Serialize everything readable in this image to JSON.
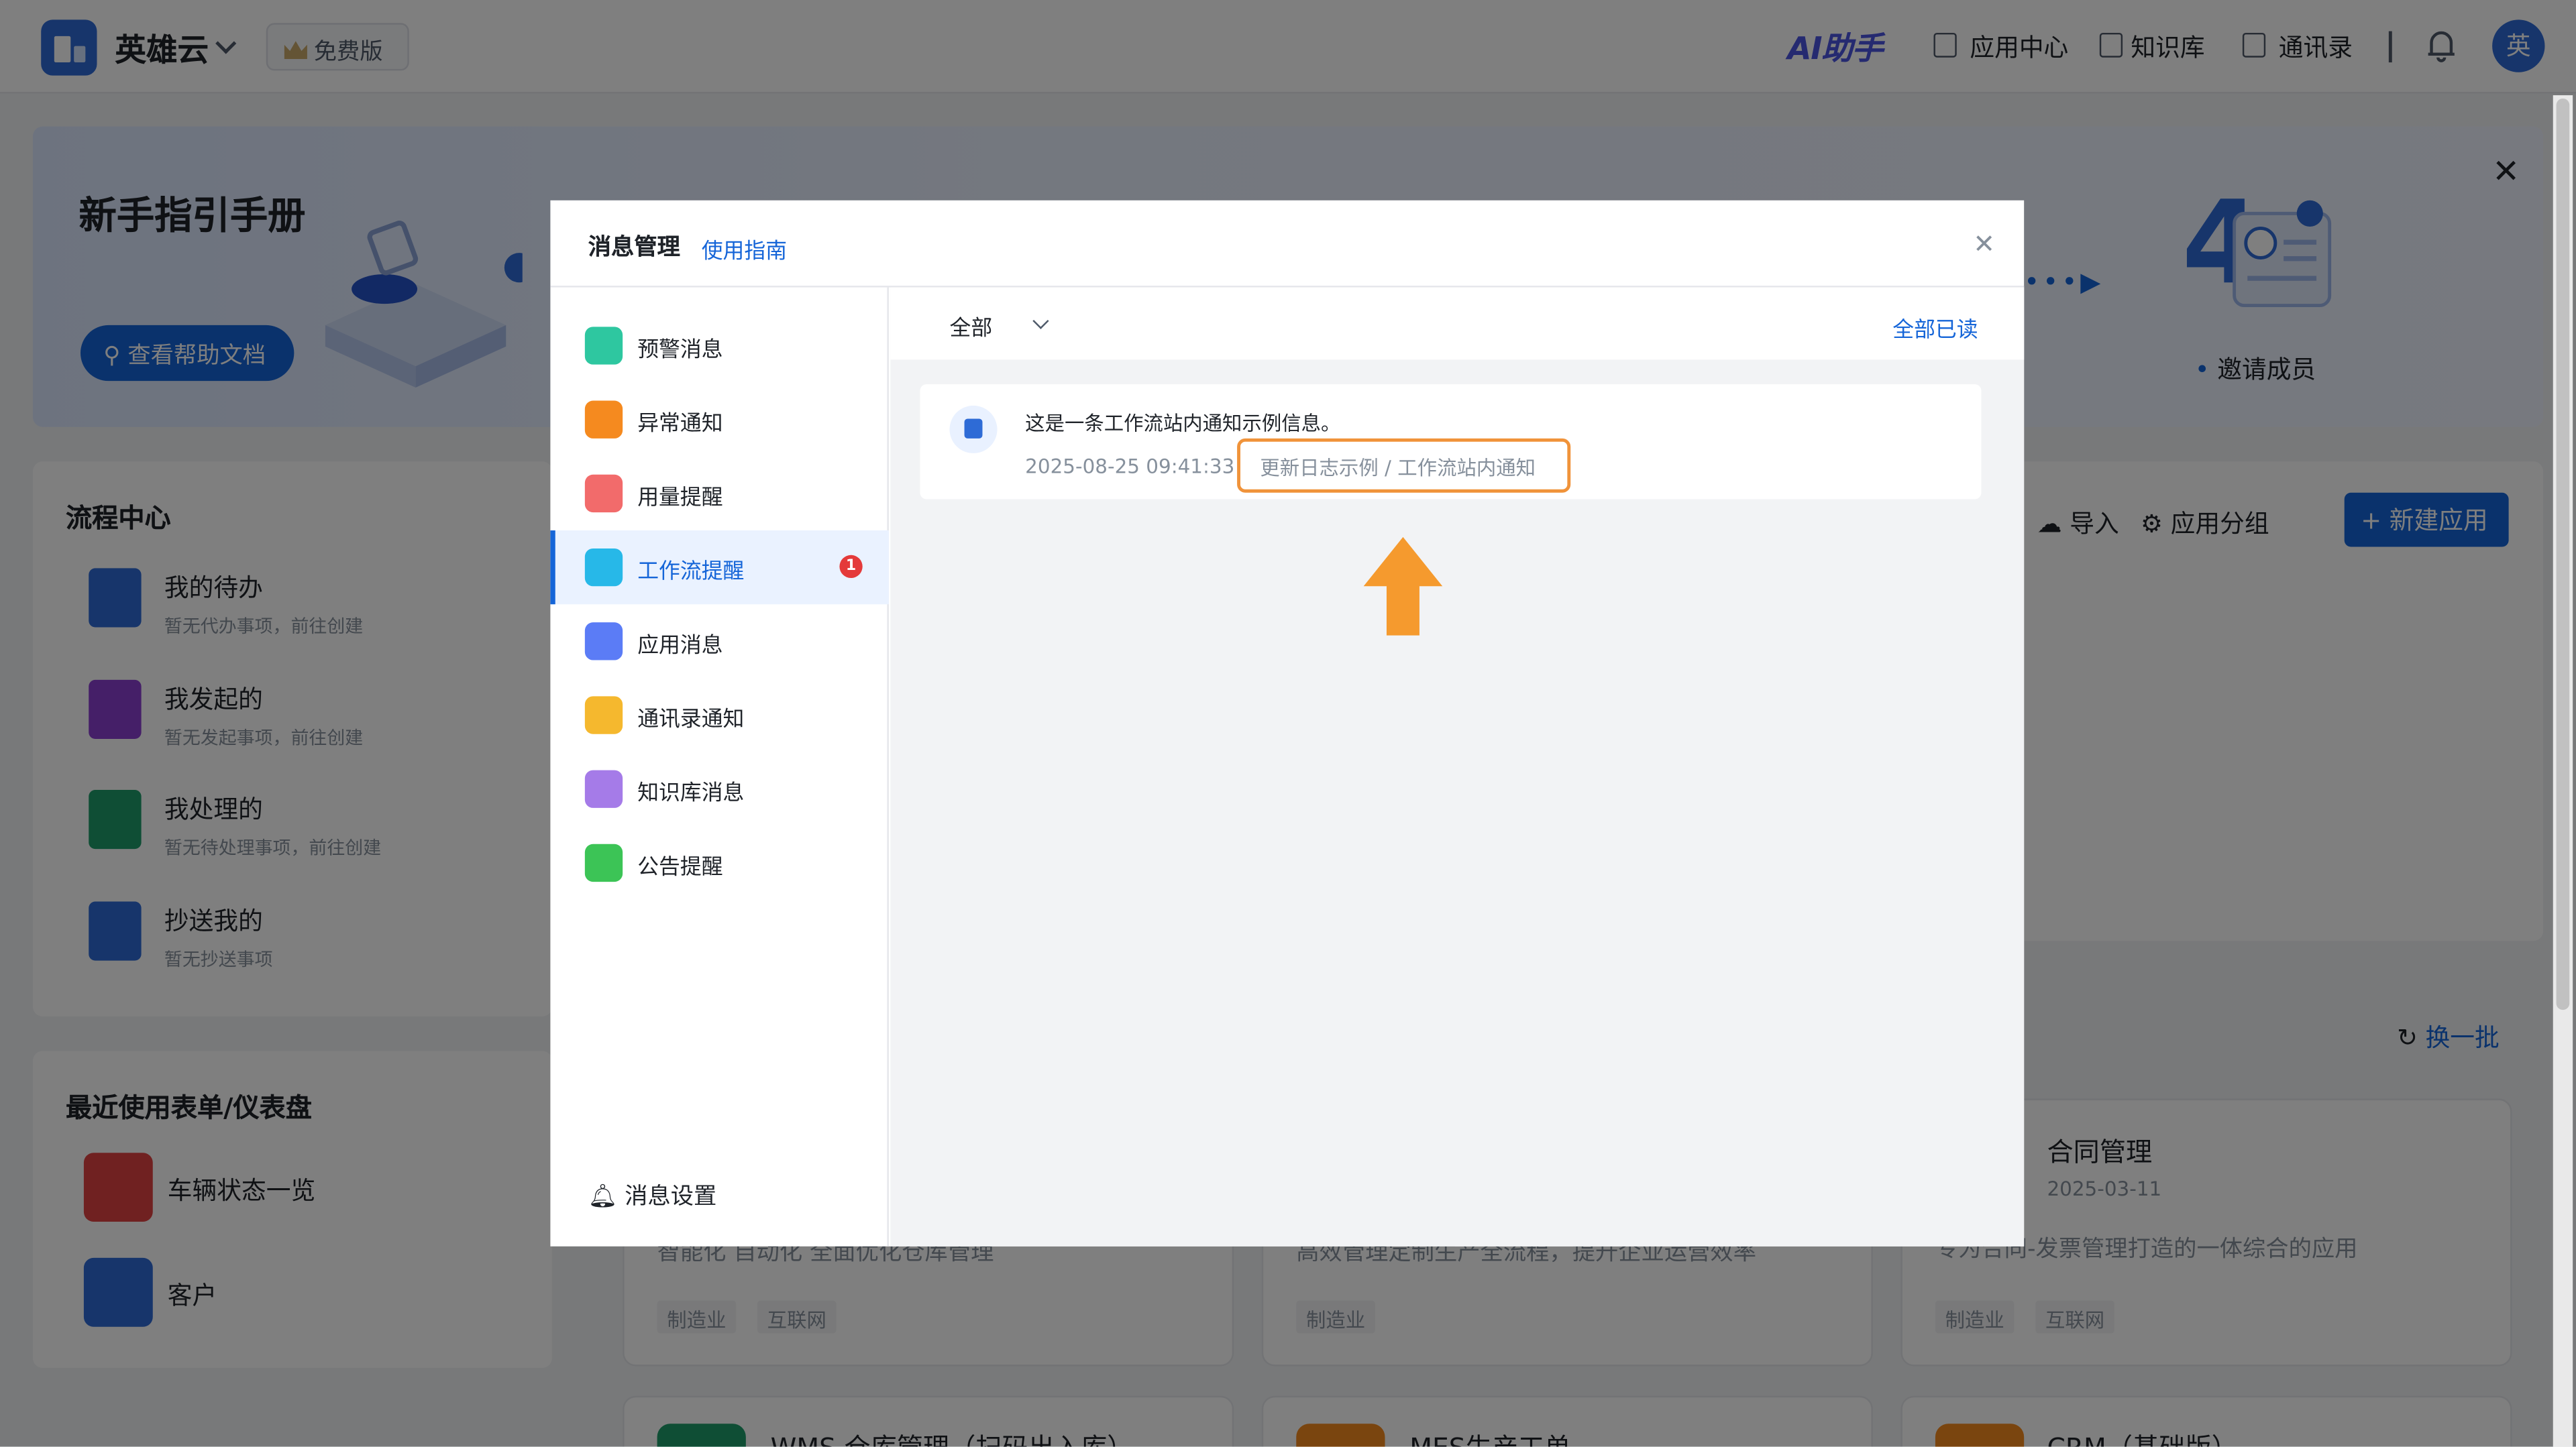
{
  "topbar": {
    "brand": "英雄云",
    "plan": "免费版",
    "ai_label": "AI助手",
    "nav": [
      "应用中心",
      "知识库",
      "通讯录"
    ],
    "avatar": "英"
  },
  "banner": {
    "title": "新手指引手册",
    "help_button": "查看帮助文档",
    "step_number": "4",
    "invite": "邀请成员"
  },
  "flow": {
    "title": "流程中心",
    "items": [
      {
        "label": "我的待办",
        "sub": "暂无代办事项，前往创建"
      },
      {
        "label": "我发起的",
        "sub": "暂无发起事项，前往创建"
      },
      {
        "label": "我处理的",
        "sub": "暂无待处理事项，前往创建"
      },
      {
        "label": "抄送我的",
        "sub": "暂无抄送事项"
      }
    ]
  },
  "recent": {
    "title": "最近使用表单/仪表盘",
    "items": [
      "车辆状态一览",
      "客户"
    ]
  },
  "apps": {
    "import": "导入",
    "group": "应用分组",
    "new": "新建应用",
    "refresh": "换一批",
    "cards": [
      {
        "desc": "智能化 自动化 全面优化仓库管理",
        "tags": [
          "制造业",
          "互联网"
        ]
      },
      {
        "desc": "高效管理定制生产全流程，提升企业运营效率",
        "tags": [
          "制造业"
        ]
      },
      {
        "title": "合同管理",
        "date": "2025-03-11",
        "desc": "专为合同-发票管理打造的一体综合的应用",
        "tags": [
          "制造业",
          "互联网"
        ]
      }
    ],
    "bottom_cards": [
      "WMS 仓库管理（扫码出入库）",
      "MES生产工单",
      "CRM（基础版）"
    ]
  },
  "modal": {
    "title": "消息管理",
    "guide": "使用指南",
    "categories": [
      {
        "label": "预警消息",
        "color": "#2ec7a0"
      },
      {
        "label": "异常通知",
        "color": "#f58a1f"
      },
      {
        "label": "用量提醒",
        "color": "#f26b6b"
      },
      {
        "label": "工作流提醒",
        "color": "#27b8e8",
        "badge": "1"
      },
      {
        "label": "应用消息",
        "color": "#5b7cf6"
      },
      {
        "label": "通讯录通知",
        "color": "#f5b82e"
      },
      {
        "label": "知识库消息",
        "color": "#a57be8"
      },
      {
        "label": "公告提醒",
        "color": "#3cc456"
      }
    ],
    "settings": "消息设置",
    "filter": "全部",
    "read_all": "全部已读",
    "message": {
      "title": "这是一条工作流站内通知示例信息。",
      "time": "2025-08-25 09:41:33",
      "source": "更新日志示例 / 工作流站内通知"
    }
  }
}
